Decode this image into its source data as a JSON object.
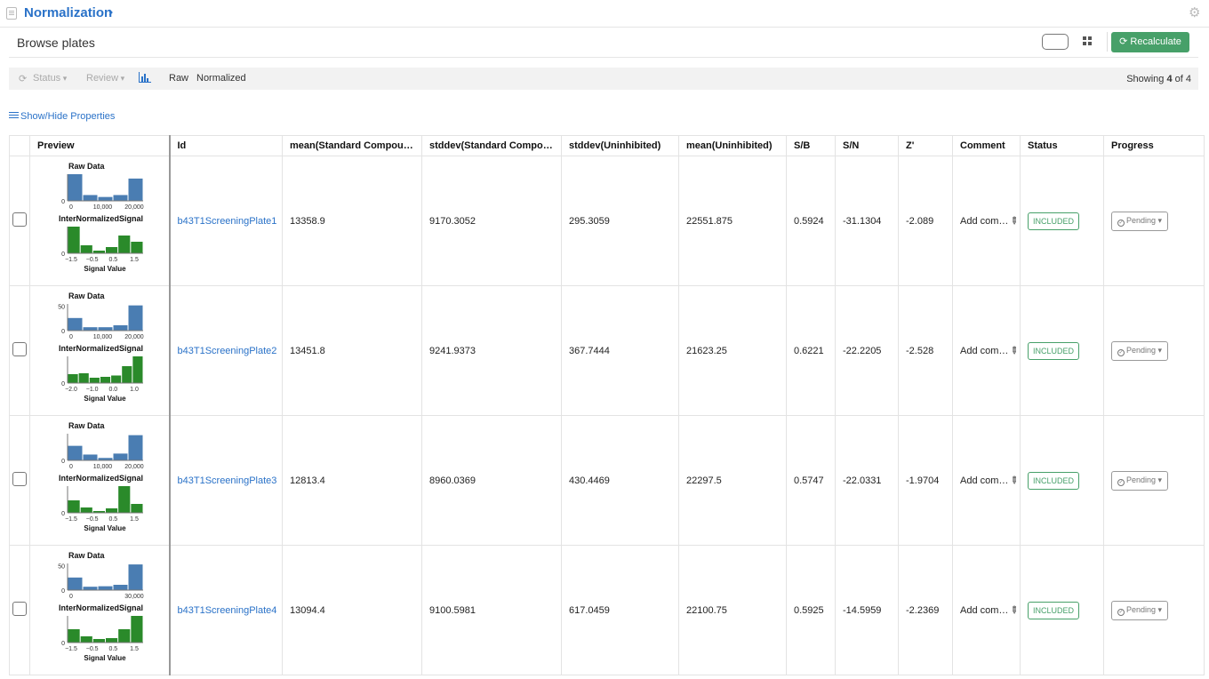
{
  "header": {
    "title": "Normalization",
    "chevron": "›"
  },
  "subheader": {
    "title": "Browse plates",
    "recalculate_label": "Recalculate",
    "recalc_icon": "refresh-icon"
  },
  "toolbar": {
    "status_label": "Status",
    "review_label": "Review",
    "raw_label": "Raw",
    "normalized_label": "Normalized",
    "showing_prefix": "Showing ",
    "showing_count": "4",
    "showing_suffix": " of 4"
  },
  "properties_link": "Show/Hide Properties",
  "colors": {
    "accent": "#2a72c8",
    "success": "#47a069",
    "raw_bar": "#4a7db2",
    "norm_bar": "#2a8a2a"
  },
  "table": {
    "headers": [
      "Preview",
      "Id",
      "mean(Standard Compou…",
      "stddev(Standard Compo…",
      "stddev(Uninhibited)",
      "mean(Uninhibited)",
      "S/B",
      "S/N",
      "Z'",
      "Comment",
      "Status",
      "Progress"
    ],
    "rows": [
      {
        "id": "b43T1ScreeningPlate1",
        "mean_std": "13358.9",
        "stddev_std": "9170.3052",
        "stddev_uninh": "295.3059",
        "mean_uninh": "22551.875",
        "sb": "0.5924",
        "sn": "-31.1304",
        "z": "-2.089",
        "comment": "Add com…",
        "status": "INCLUDED",
        "progress": "Pending"
      },
      {
        "id": "b43T1ScreeningPlate2",
        "mean_std": "13451.8",
        "stddev_std": "9241.9373",
        "stddev_uninh": "367.7444",
        "mean_uninh": "21623.25",
        "sb": "0.6221",
        "sn": "-22.2205",
        "z": "-2.528",
        "comment": "Add com…",
        "status": "INCLUDED",
        "progress": "Pending"
      },
      {
        "id": "b43T1ScreeningPlate3",
        "mean_std": "12813.4",
        "stddev_std": "8960.0369",
        "stddev_uninh": "430.4469",
        "mean_uninh": "22297.5",
        "sb": "0.5747",
        "sn": "-22.0331",
        "z": "-1.9704",
        "comment": "Add com…",
        "status": "INCLUDED",
        "progress": "Pending"
      },
      {
        "id": "b43T1ScreeningPlate4",
        "mean_std": "13094.4",
        "stddev_std": "9100.5981",
        "stddev_uninh": "617.0459",
        "mean_uninh": "22100.75",
        "sb": "0.5925",
        "sn": "-14.5959",
        "z": "-2.2369",
        "comment": "Add com…",
        "status": "INCLUDED",
        "progress": "Pending"
      }
    ]
  },
  "chart_data": [
    {
      "type": "bar",
      "title": "Raw Data",
      "y_ticks": [
        "0"
      ],
      "x_ticks": [
        "0",
        "10,000",
        "20,000"
      ],
      "values": [
        0.55,
        0.12,
        0.08,
        0.12,
        0.46
      ],
      "ylim": [
        0,
        0.55
      ]
    },
    {
      "type": "bar",
      "title": "InterNormalizedSignal",
      "xlabel": "Signal Value",
      "y_ticks": [
        "0"
      ],
      "x_ticks": [
        "−1.5",
        "−0.5",
        "0.5",
        "1.5"
      ],
      "values": [
        0.6,
        0.18,
        0.06,
        0.14,
        0.4,
        0.26
      ],
      "ylim": [
        0,
        0.6
      ]
    },
    {
      "type": "bar",
      "title": "Raw Data",
      "y_ticks": [
        "50",
        "0"
      ],
      "x_ticks": [
        "0",
        "10,000",
        "20,000"
      ],
      "values": [
        26,
        7,
        7,
        11,
        52
      ],
      "ylim": [
        0,
        55
      ]
    },
    {
      "type": "bar",
      "title": "InterNormalizedSignal",
      "xlabel": "Signal Value",
      "y_ticks": [
        "0"
      ],
      "x_ticks": [
        "−2.0",
        "−1.0",
        "0.0",
        "1.0"
      ],
      "values": [
        0.2,
        0.22,
        0.12,
        0.14,
        0.17,
        0.38,
        0.6
      ],
      "ylim": [
        0,
        0.6
      ]
    },
    {
      "type": "bar",
      "title": "Raw Data",
      "y_ticks": [
        "0"
      ],
      "x_ticks": [
        "0",
        "10,000",
        "20,000"
      ],
      "values": [
        0.3,
        0.12,
        0.05,
        0.14,
        0.52
      ],
      "ylim": [
        0,
        0.55
      ]
    },
    {
      "type": "bar",
      "title": "InterNormalizedSignal",
      "xlabel": "Signal Value",
      "y_ticks": [
        "0"
      ],
      "x_ticks": [
        "−1.5",
        "−0.5",
        "0.5",
        "1.5"
      ],
      "values": [
        0.28,
        0.12,
        0.04,
        0.1,
        0.6,
        0.2
      ],
      "ylim": [
        0,
        0.6
      ]
    },
    {
      "type": "bar",
      "title": "Raw Data",
      "y_ticks": [
        "50",
        "0"
      ],
      "x_ticks": [
        "0",
        "30,000"
      ],
      "values": [
        26,
        7,
        8,
        11,
        53
      ],
      "ylim": [
        0,
        55
      ]
    },
    {
      "type": "bar",
      "title": "InterNormalizedSignal",
      "xlabel": "Signal Value",
      "y_ticks": [
        "0"
      ],
      "x_ticks": [
        "−1.5",
        "−0.5",
        "0.5",
        "1.5"
      ],
      "values": [
        0.3,
        0.14,
        0.08,
        0.1,
        0.3,
        0.6
      ],
      "ylim": [
        0,
        0.6
      ]
    }
  ]
}
